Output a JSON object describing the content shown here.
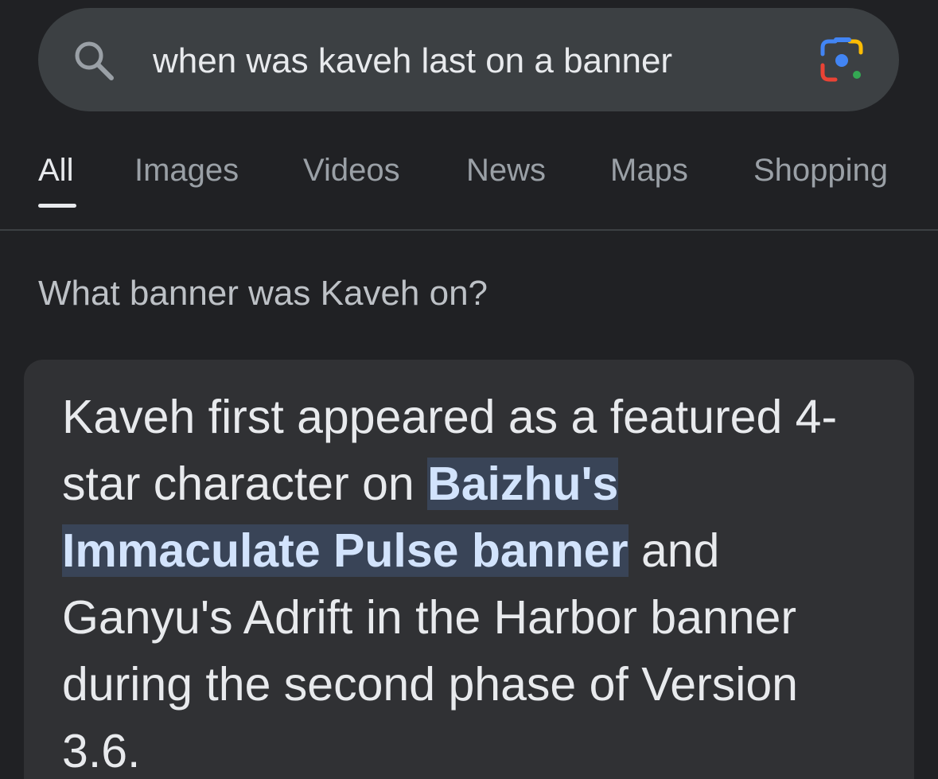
{
  "search": {
    "query": "when was kaveh last on a banner",
    "search_icon": "search-icon",
    "lens_icon": "google-lens-icon"
  },
  "tabs": [
    {
      "label": "All",
      "active": true
    },
    {
      "label": "Images",
      "active": false
    },
    {
      "label": "Videos",
      "active": false
    },
    {
      "label": "News",
      "active": false
    },
    {
      "label": "Maps",
      "active": false
    },
    {
      "label": "Shopping",
      "active": false
    }
  ],
  "question": "What banner was Kaveh on?",
  "answer": {
    "before": "Kaveh first appeared as a featured 4-star character on ",
    "highlight": "Baizhu's Immaculate Pulse banner",
    "after": " and Ganyu's Adrift in the Harbor banner during the second phase of Version 3.6."
  },
  "colors": {
    "background": "#202124",
    "search_bar": "#3c4043",
    "card": "#303134",
    "highlight_bg": "#394457",
    "highlight_text": "#d2e3fc"
  }
}
